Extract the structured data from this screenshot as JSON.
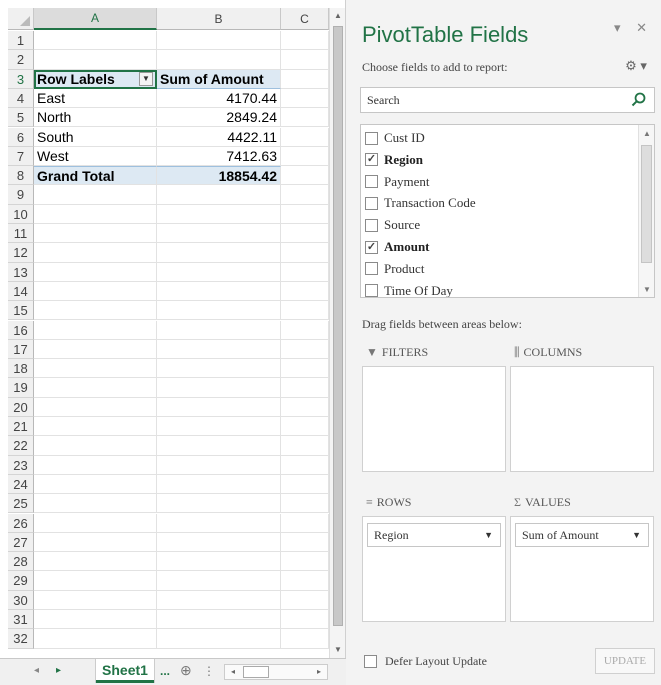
{
  "spreadsheet": {
    "columns": [
      "A",
      "B",
      "C"
    ],
    "rows": [
      "1",
      "2",
      "3",
      "4",
      "5",
      "6",
      "7",
      "8",
      "9",
      "10",
      "11",
      "12",
      "13",
      "14",
      "15",
      "16",
      "17",
      "18",
      "19",
      "20",
      "21",
      "22",
      "23",
      "24",
      "25",
      "26",
      "27",
      "28",
      "29",
      "30",
      "31",
      "32"
    ],
    "pivot": {
      "header": {
        "label": "Row Labels",
        "value": "Sum of Amount"
      },
      "items": [
        {
          "label": "East",
          "value": "4170.44"
        },
        {
          "label": "North",
          "value": "2849.24"
        },
        {
          "label": "South",
          "value": "4422.11"
        },
        {
          "label": "West",
          "value": "7412.63"
        }
      ],
      "total": {
        "label": "Grand Total",
        "value": "18854.42"
      }
    },
    "sheet_tab": "Sheet1",
    "tab_more": "...",
    "add_sheet_icon": "⊕",
    "tab_options_icon": "⋮",
    "nav_left_icon": "◂",
    "nav_right_icon": "▸",
    "scroll_up_icon": "▲",
    "scroll_down_icon": "▼"
  },
  "pane": {
    "title": "PivotTable Fields",
    "controls": "▾ ✕",
    "subtitle": "Choose fields to add to report:",
    "gear": "⚙ ▾",
    "search_placeholder": "Search",
    "fields": [
      {
        "label": "Cust ID",
        "checked": false
      },
      {
        "label": "Region",
        "checked": true
      },
      {
        "label": "Payment",
        "checked": false
      },
      {
        "label": "Transaction Code",
        "checked": false
      },
      {
        "label": "Source",
        "checked": false
      },
      {
        "label": "Amount",
        "checked": true
      },
      {
        "label": "Product",
        "checked": false
      },
      {
        "label": "Time Of Day",
        "checked": false
      }
    ],
    "drag_hint": "Drag fields between areas below:",
    "areas": {
      "filters": {
        "label": "FILTERS",
        "icon": "▼"
      },
      "columns": {
        "label": "COLUMNS",
        "icon": "⫼"
      },
      "rows": {
        "label": "ROWS",
        "icon": "≡",
        "item": "Region"
      },
      "values": {
        "label": "VALUES",
        "icon": "Σ",
        "item": "Sum of Amount"
      }
    },
    "defer_label": "Defer Layout Update",
    "update_label": "UPDATE",
    "colors": {
      "accent": "#217346",
      "pivot_fill": "#dde9f3"
    }
  }
}
